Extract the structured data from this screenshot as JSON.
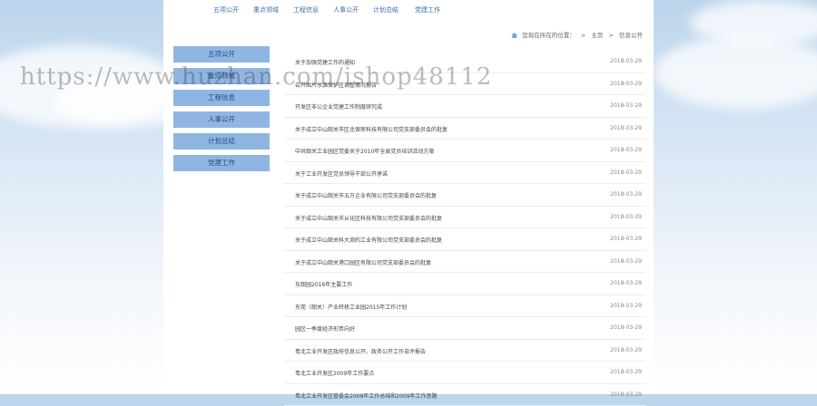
{
  "nav": [
    "五项公开",
    "重点领域",
    "工程信息",
    "人事公开",
    "计划总结",
    "党建工作"
  ],
  "breadcrumb": {
    "prefix": "您现在所在的位置：",
    "home": "主页",
    "sep": ">",
    "current": "信息公开"
  },
  "sidebar": [
    "五项公开",
    "重点领域",
    "工程信息",
    "人事公开",
    "计划总结",
    "党建工作"
  ],
  "list": [
    {
      "title": "关于加强党建工作的通知",
      "date": "2018-03-29"
    },
    {
      "title": "召开图片水源保护区调整情况报告",
      "date": "2018-03-29"
    },
    {
      "title": "开发区非公企业党建工作制度研究成",
      "date": "2018-03-29"
    },
    {
      "title": "关于成立中山韶关市区北保密科技有限公司党支部委员会的批复",
      "date": "2018-03-29"
    },
    {
      "title": "中共韶关工业园区党委关于2010年全县党员培训活动方案",
      "date": "2018-03-29"
    },
    {
      "title": "关于工业开发区党员领导干部公开承诺",
      "date": "2018-03-29"
    },
    {
      "title": "关于成立中山韶关市五万企业有限公司党支部委员会的批复",
      "date": "2018-03-29"
    },
    {
      "title": "关于成立中山韶关市从化区科技有限公司党支部委员会的批复",
      "date": "2018-03-29"
    },
    {
      "title": "关于成立中山韶关科大测的工业有限公司党支部委员会的批复",
      "date": "2018-03-29"
    },
    {
      "title": "关于成立中山韶关港口园区有限公司党支部委员会的批复",
      "date": "2018-03-29"
    },
    {
      "title": "东韶园2016年主要工作",
      "date": "2018-03-29"
    },
    {
      "title": "东莞（韶关）产业转移工业园2015年工作计划",
      "date": "2018-03-29"
    },
    {
      "title": "园区一季度经济形势向好",
      "date": "2018-03-29"
    },
    {
      "title": "粤北工业开发区政府信息公开、政务公开工作自评报告",
      "date": "2018-03-29"
    },
    {
      "title": "粤北工业开发区2009年工作要点",
      "date": "2018-03-29"
    },
    {
      "title": "粤北工业开发区管委会2008年工作总结和2009年工作思路",
      "date": "2018-03-29"
    }
  ],
  "watermark": "https://www.huzhan.com/ishop48112",
  "colors": {
    "sidebar_bg": "#8fb6e3",
    "nav_text": "#3a6ea5"
  }
}
